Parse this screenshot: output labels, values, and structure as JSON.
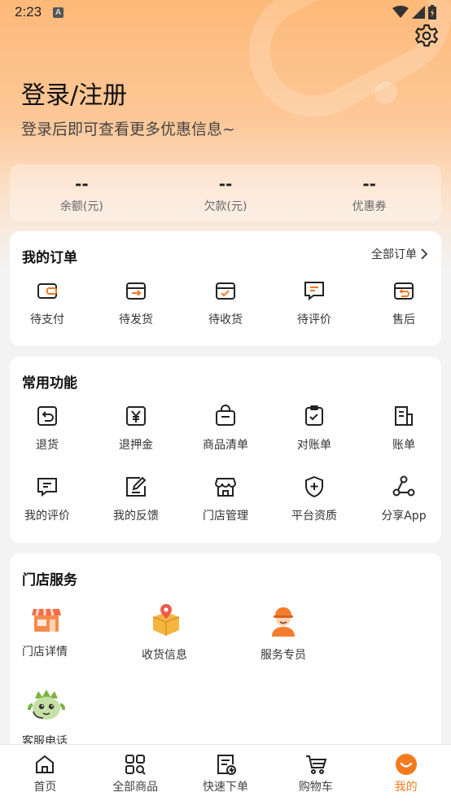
{
  "status_bar": {
    "time": "2:23",
    "notification_glyph": "A"
  },
  "header": {
    "title": "登录/注册",
    "subtitle": "登录后即可查看更多优惠信息~"
  },
  "stats": [
    {
      "value": "--",
      "label": "余额(元)"
    },
    {
      "value": "--",
      "label": "欠款(元)"
    },
    {
      "value": "--",
      "label": "优惠券"
    }
  ],
  "orders": {
    "title": "我的订单",
    "all_link": "全部订单",
    "items": [
      {
        "label": "待支付",
        "icon": "wallet-icon"
      },
      {
        "label": "待发货",
        "icon": "box-arrow-icon"
      },
      {
        "label": "待收货",
        "icon": "box-check-icon"
      },
      {
        "label": "待评价",
        "icon": "comment-icon"
      },
      {
        "label": "售后",
        "icon": "box-return-icon"
      }
    ]
  },
  "functions": {
    "title": "常用功能",
    "items": [
      {
        "label": "退货",
        "icon": "return-icon"
      },
      {
        "label": "退押金",
        "icon": "yen-icon"
      },
      {
        "label": "商品清单",
        "icon": "bag-icon"
      },
      {
        "label": "对账单",
        "icon": "clipboard-check-icon"
      },
      {
        "label": "账单",
        "icon": "bill-icon"
      },
      {
        "label": "我的评价",
        "icon": "comment-icon"
      },
      {
        "label": "我的反馈",
        "icon": "edit-icon"
      },
      {
        "label": "门店管理",
        "icon": "store-icon"
      },
      {
        "label": "平台资质",
        "icon": "shield-plus-icon"
      },
      {
        "label": "分享App",
        "icon": "share-icon"
      }
    ]
  },
  "store_services": {
    "title": "门店服务",
    "items": [
      {
        "label": "门店详情",
        "icon": "shop-illustration-icon"
      },
      {
        "label": "收货信息",
        "icon": "package-location-icon"
      },
      {
        "label": "服务专员",
        "icon": "courier-icon"
      },
      {
        "label": "客服电话",
        "icon": "mascot-headset-icon"
      }
    ]
  },
  "tabbar": [
    {
      "label": "首页",
      "icon": "home-icon",
      "active": false
    },
    {
      "label": "全部商品",
      "icon": "grid-search-icon",
      "active": false
    },
    {
      "label": "快速下单",
      "icon": "quick-order-icon",
      "active": false
    },
    {
      "label": "购物车",
      "icon": "cart-icon",
      "active": false
    },
    {
      "label": "我的",
      "icon": "smile-icon",
      "active": true
    }
  ],
  "colors": {
    "accent": "#f47a20",
    "header_gradient_top": "#fdb978"
  }
}
